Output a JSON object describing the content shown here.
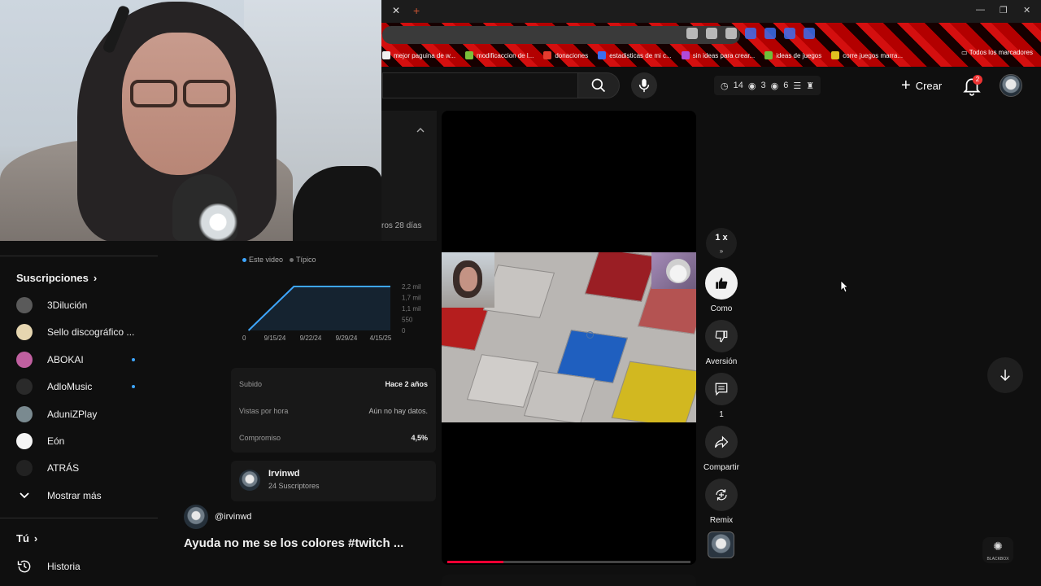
{
  "browser": {
    "bookmarks": [
      {
        "label": "mejor paguina de w...",
        "color": "#f0f0f0"
      },
      {
        "label": "modificaccion de l...",
        "color": "#7bbf3a"
      },
      {
        "label": "donaciones",
        "color": "#e33b2e"
      },
      {
        "label": "estadisticas de mi c...",
        "color": "#3b6ef0"
      },
      {
        "label": "sin ideas para crear...",
        "color": "#b04ad8"
      },
      {
        "label": "ideas de juegos",
        "color": "#6fbf3a"
      },
      {
        "label": "corre juegos marra...",
        "color": "#e0c020"
      }
    ],
    "all_bookmarks": "Todos los marcadores"
  },
  "masthead": {
    "ext_stats": [
      "14",
      "3",
      "6"
    ],
    "create_label": "Crear",
    "notifications": "2"
  },
  "sidebar": {
    "subscriptions_heading": "Suscripciones",
    "subscriptions": [
      {
        "name": "3Dilución",
        "color": "#5a5a5a",
        "dot": false
      },
      {
        "name": "Sello discográfico ...",
        "color": "#e6d6b0",
        "dot": false
      },
      {
        "name": "ABOKAI",
        "color": "#c060a0",
        "dot": true
      },
      {
        "name": "AdloMusic",
        "color": "#2a2a2a",
        "dot": true
      },
      {
        "name": "AduniZPlay",
        "color": "#7a8a90",
        "dot": false
      },
      {
        "name": "Eón",
        "color": "#f5f5f5",
        "dot": false
      },
      {
        "name": "ATRÁS",
        "color": "#222222",
        "dot": false
      }
    ],
    "show_more": "Mostrar más",
    "you_heading": "Tú",
    "history": "Historia"
  },
  "analytics": {
    "period": "ros 28 días",
    "legend": {
      "this_video": "Este video",
      "typical": "Típico"
    },
    "stats": [
      {
        "label": "Subido",
        "value": "Hace 2 años"
      },
      {
        "label": "Vistas por hora",
        "value": "Aún no hay datos."
      },
      {
        "label": "Compromiso",
        "value": "4,5%"
      }
    ],
    "channel": {
      "name": "Irvinwd",
      "subs": "24 Suscriptores"
    }
  },
  "chart_data": {
    "type": "line",
    "x": [
      "9/15/24",
      "9/22/24",
      "9/29/24",
      "4/15/25"
    ],
    "series": [
      {
        "name": "Este video",
        "values": [
          0,
          2200,
          2200,
          2200
        ]
      }
    ],
    "yticks": [
      "2,2 mil",
      "1,7 mil",
      "1,1 mil",
      "550",
      "0"
    ],
    "x_origin_label": "0",
    "ylim": [
      0,
      2200
    ],
    "colors": {
      "this_video": "#3ea6ff",
      "typical": "#717171"
    }
  },
  "video": {
    "owner_handle": "@irvinwd",
    "title": "Ayuda no me se los colores #twitch  ...",
    "progress": 0.23
  },
  "actions": {
    "speed": "1 x",
    "like": "Como",
    "dislike": "Aversión",
    "comments": "1",
    "share": "Compartir",
    "remix": "Remix"
  },
  "overlay": {
    "blackbox": "BLACKBOX"
  }
}
